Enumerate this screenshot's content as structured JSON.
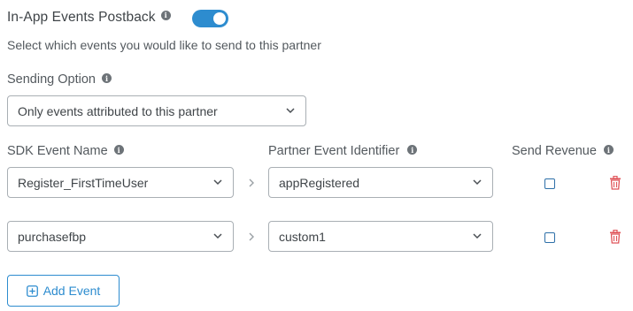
{
  "header": {
    "title": "In-App Events Postback",
    "description": "Select which events you would like to send to this partner",
    "postback_enabled": true
  },
  "sending_option": {
    "label": "Sending Option",
    "selected": "Only events attributed to this partner"
  },
  "columns": {
    "sdk_event": "SDK Event Name",
    "partner_event": "Partner Event Identifier",
    "send_revenue": "Send Revenue"
  },
  "rows": [
    {
      "sdk_event": "Register_FirstTimeUser",
      "partner_event": "appRegistered",
      "send_revenue": false
    },
    {
      "sdk_event": "purchasefbp",
      "partner_event": "custom1",
      "send_revenue": false
    }
  ],
  "add_button": {
    "label": "Add Event"
  },
  "icons": {
    "info": "info-icon",
    "chevron": "chevron-down-icon",
    "arrow": "chevron-right-icon",
    "trash": "trash-icon",
    "add": "plus-square-icon"
  },
  "colors": {
    "accent": "#2d8ccf",
    "danger": "#e0555a",
    "text": "#3f4448"
  }
}
